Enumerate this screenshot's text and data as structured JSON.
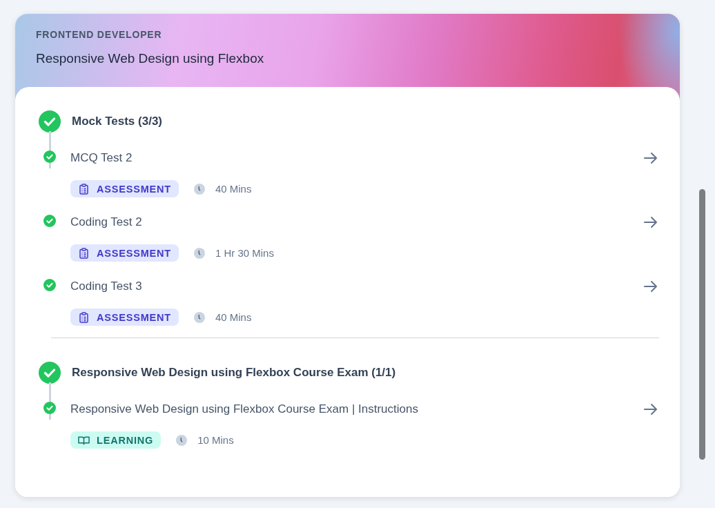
{
  "header": {
    "eyebrow": "FRONTEND DEVELOPER",
    "title": "Responsive Web Design using Flexbox"
  },
  "sections": [
    {
      "title": "Mock Tests (3/3)",
      "completed": true,
      "items": [
        {
          "title": "MCQ Test 2",
          "completed": true,
          "kind": "assessment",
          "tag": "ASSESSMENT",
          "duration": "40 Mins"
        },
        {
          "title": "Coding Test 2",
          "completed": true,
          "kind": "assessment",
          "tag": "ASSESSMENT",
          "duration": "1 Hr 30 Mins"
        },
        {
          "title": "Coding Test 3",
          "completed": true,
          "kind": "assessment",
          "tag": "ASSESSMENT",
          "duration": "40 Mins"
        }
      ]
    },
    {
      "title": "Responsive Web Design using Flexbox Course Exam (1/1)",
      "completed": true,
      "items": [
        {
          "title": "Responsive Web Design using Flexbox Course Exam | Instructions",
          "completed": true,
          "kind": "learning",
          "tag": "LEARNING",
          "duration": "10 Mins"
        }
      ]
    }
  ]
}
